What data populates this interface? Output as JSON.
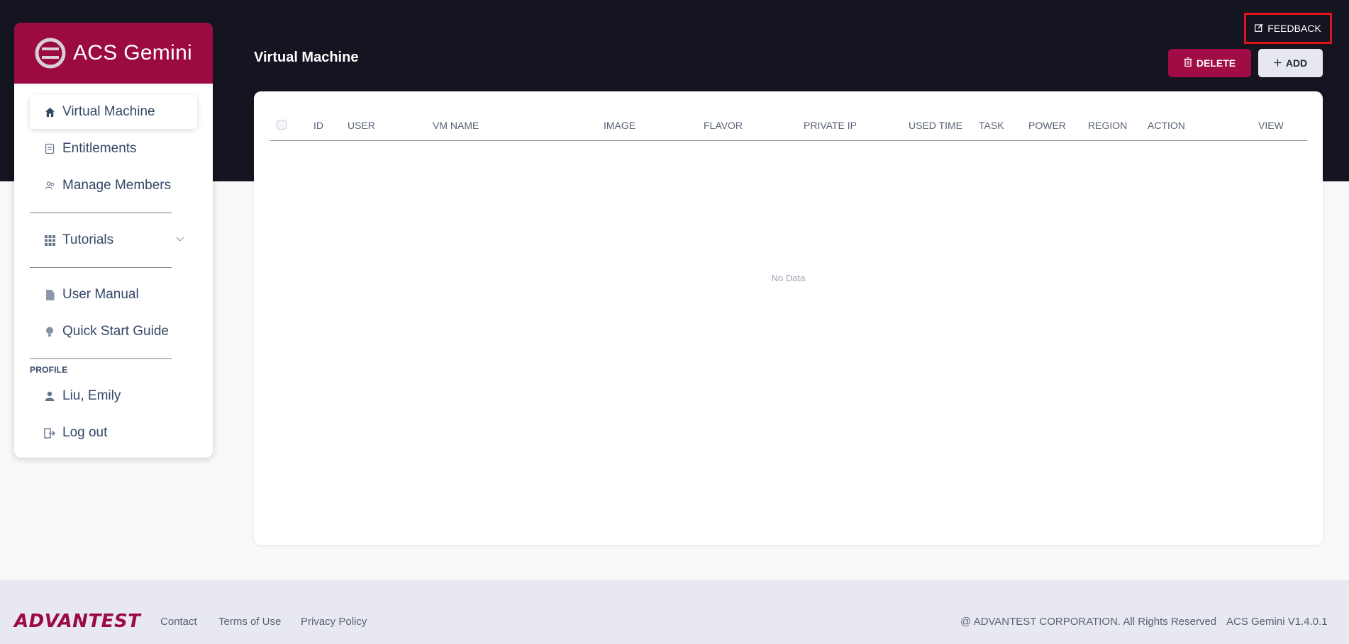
{
  "app": {
    "name": "ACS Gemini",
    "version": "ACS Gemini V1.4.0.1"
  },
  "sidebar": {
    "items": [
      {
        "label": "Virtual Machine",
        "icon": "home-icon",
        "active": true
      },
      {
        "label": "Entitlements",
        "icon": "clipboard-icon"
      },
      {
        "label": "Manage Members",
        "icon": "users-icon"
      }
    ],
    "tutorials": {
      "label": "Tutorials",
      "icon": "grid-icon"
    },
    "docs": [
      {
        "label": "User Manual",
        "icon": "document-icon"
      },
      {
        "label": "Quick Start Guide",
        "icon": "lightbulb-icon"
      }
    ],
    "profile_label": "PROFILE",
    "user_name": "Liu, Emily",
    "logout_label": "Log out"
  },
  "header": {
    "title": "Virtual Machine",
    "feedback_label": "FEEDBACK",
    "delete_label": "DELETE",
    "add_label": "ADD"
  },
  "table": {
    "columns": [
      "ID",
      "USER",
      "VM NAME",
      "IMAGE",
      "FLAVOR",
      "PRIVATE IP",
      "USED TIME",
      "TASK",
      "POWER",
      "REGION",
      "ACTION",
      "VIEW"
    ],
    "rows": [],
    "empty_text": "No Data"
  },
  "footer": {
    "logo": "ADVANTEST",
    "links": [
      "Contact",
      "Terms of Use",
      "Privacy Policy"
    ],
    "copyright": "@ ADVANTEST CORPORATION. All Rights Reserved"
  },
  "colors": {
    "brand": "#9b0a40",
    "header_bg": "#141520",
    "feedback_border": "#e2131c"
  }
}
